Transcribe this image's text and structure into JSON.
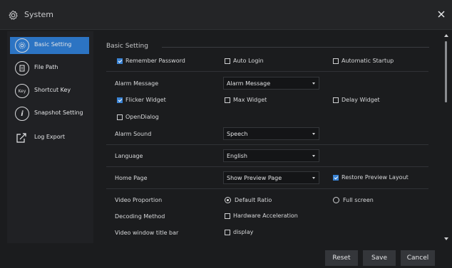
{
  "window": {
    "title": "System",
    "icon": "gear-icon",
    "close_icon": "close-icon"
  },
  "sidebar": {
    "items": [
      {
        "label": "Basic Setting",
        "icon": "gear-icon",
        "active": true
      },
      {
        "label": "File Path",
        "icon": "document-icon",
        "active": false
      },
      {
        "label": "Shortcut Key",
        "icon": "key-icon",
        "icon_text": "Key",
        "active": false
      },
      {
        "label": "Snapshot Setting",
        "icon": "info-icon",
        "icon_text": "i",
        "active": false
      },
      {
        "label": "Log Export",
        "icon": "export-icon",
        "active": false
      }
    ]
  },
  "content": {
    "section_title": "Basic Setting",
    "remember_password": {
      "label": "Remember Password",
      "checked": true
    },
    "auto_login": {
      "label": "Auto Login",
      "checked": false
    },
    "automatic_startup": {
      "label": "Automatic Startup",
      "checked": false
    },
    "alarm_message": {
      "label": "Alarm Message",
      "value": "Alarm Message"
    },
    "flicker_widget": {
      "label": "Flicker Widget",
      "checked": true
    },
    "max_widget": {
      "label": "Max Widget",
      "checked": false
    },
    "delay_widget": {
      "label": "Delay Widget",
      "checked": false
    },
    "open_dialog": {
      "label": "OpenDialog",
      "checked": false
    },
    "alarm_sound": {
      "label": "Alarm Sound",
      "value": "Speech"
    },
    "language": {
      "label": "Language",
      "value": "English"
    },
    "home_page": {
      "label": "Home Page",
      "value": "Show Preview Page"
    },
    "restore_preview_layout": {
      "label": "Restore Preview Layout",
      "checked": true
    },
    "video_proportion": {
      "label": "Video Proportion",
      "options": [
        "Default Ratio",
        "Full screen"
      ],
      "selected": "Default Ratio"
    },
    "decoding_method": {
      "label": "Decoding Method",
      "option_label": "Hardware Acceleration",
      "checked": false
    },
    "video_window_title_bar": {
      "label": "Video window title bar",
      "option_label": "display",
      "checked": false
    }
  },
  "footer": {
    "reset_label": "Reset",
    "save_label": "Save",
    "cancel_label": "Cancel"
  },
  "colors": {
    "accent": "#2c74c3",
    "checkbox_on": "#3a83d4",
    "background": "#1b1c1e"
  }
}
